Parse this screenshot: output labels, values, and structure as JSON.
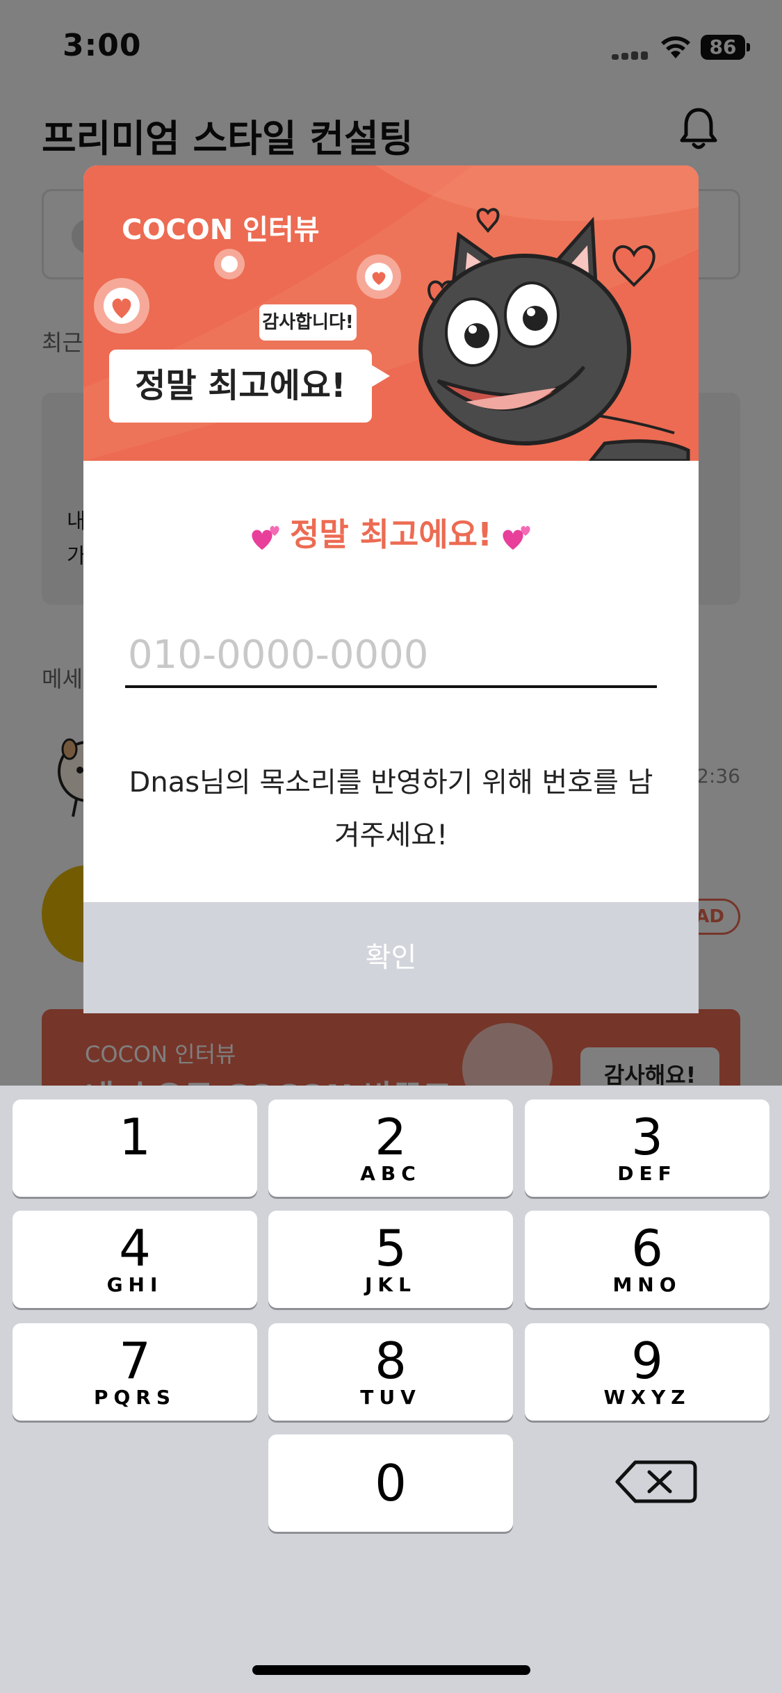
{
  "status_bar": {
    "time": "3:00",
    "battery": "86"
  },
  "page": {
    "title": "프리미엄 스타일 컨설팅",
    "recent_label": "최근",
    "recent_card": {
      "line1": "내",
      "line2": "가"
    },
    "messages_label": "메세",
    "message_time": "2:36",
    "message_badge": "AD"
  },
  "banner": {
    "subtitle": "COCON 인터뷰",
    "title": "내 손으로 COCON 바꾸고",
    "bubble": "감사해요!"
  },
  "modal": {
    "brand": "COCON 인터뷰",
    "small_bubble": "감사합니다!",
    "big_bubble": "정말 최고에요!",
    "title": "정말 최고에요!",
    "phone_placeholder": "010-0000-0000",
    "phone_value": "",
    "description": "Dnas님의 목소리를 반영하기 위해 번호를 남겨주세요!",
    "confirm_label": "확인"
  },
  "keypad": {
    "keys": [
      {
        "digit": "1",
        "letters": ""
      },
      {
        "digit": "2",
        "letters": "ABC"
      },
      {
        "digit": "3",
        "letters": "DEF"
      },
      {
        "digit": "4",
        "letters": "GHI"
      },
      {
        "digit": "5",
        "letters": "JKL"
      },
      {
        "digit": "6",
        "letters": "MNO"
      },
      {
        "digit": "7",
        "letters": "PQRS"
      },
      {
        "digit": "8",
        "letters": "TUV"
      },
      {
        "digit": "9",
        "letters": "WXYZ"
      },
      {
        "digit": "0",
        "letters": ""
      }
    ]
  },
  "colors": {
    "accent": "#ec6b52",
    "keypad_bg": "#d1d3d9",
    "confirm_disabled": "#d2d4db"
  }
}
